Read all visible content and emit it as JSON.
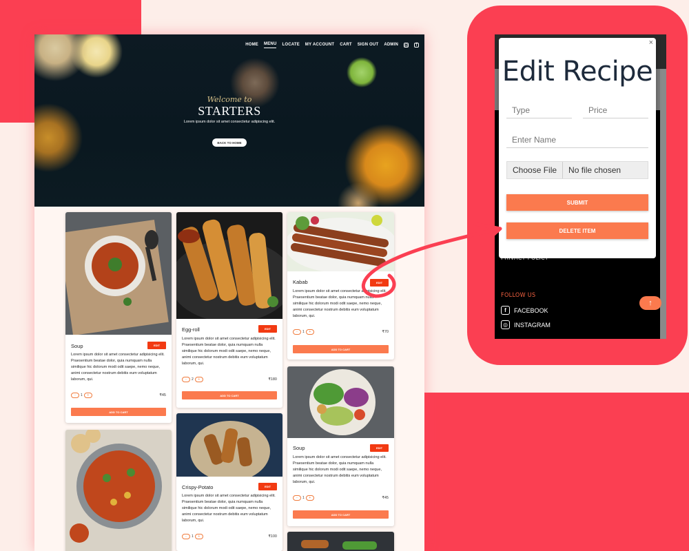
{
  "colors": {
    "brand_red": "#fb3f52",
    "accent_orange": "#fb7a4e",
    "edit_red": "#f23a12"
  },
  "nav": {
    "items": [
      "HOME",
      "MENU",
      "LOCATE",
      "MY ACCOUNT",
      "CART",
      "SIGN OUT",
      "ADMIN"
    ],
    "active": "MENU",
    "icons": [
      "instagram-icon",
      "facebook-icon"
    ]
  },
  "hero": {
    "welcome": "Welcome to",
    "title": "STARTERS",
    "subtitle": "Lorem ipsum dolor sit amet consectetur adipiscing elit.",
    "button": "BACK TO HOME"
  },
  "cards": [
    {
      "title": "Soup",
      "edit": "EDIT",
      "desc": "Lorem ipsum dolor sit amet consectetur adipisicing elit. Praesentium beatae dolor, quia numquam nulla similique hic dolorum modi odit saepe, nemo neque, animi consectetur nostrum debitis eum voluptatum laborum, qui.",
      "qty": "1",
      "price": "₹45",
      "cart": "ADD TO CART"
    },
    {
      "title": "Egg-roll",
      "edit": "EDIT",
      "desc": "Lorem ipsum dolor sit amet consectetur adipisicing elit. Praesentium beatae dolor, quia numquam nulla similique hic dolorum modi odit saepe, nemo neque, animi consectetur nostrum debitis eum voluptatum laborum, qui.",
      "qty": "2",
      "price": "₹180",
      "cart": "ADD TO CART"
    },
    {
      "title": "Kabab",
      "edit": "EDIT",
      "desc": "Lorem ipsum dolor sit amet consectetur adipisicing elit. Praesentium beatae dolor, quia numquam nulla similique hic dolorum modi odit saepe, nemo neque, animi consectetur nostrum debitis eum voluptatum laborum, qui.",
      "qty": "1",
      "price": "₹70",
      "cart": "ADD TO CART"
    },
    {
      "title": "Crispy-Potato",
      "edit": "EDIT",
      "desc": "Lorem ipsum dolor sit amet consectetur adipisicing elit. Praesentium beatae dolor, quia numquam nulla similique hic dolorum modi odit saepe, nemo neque, animi consectetur nostrum debitis eum voluptatum laborum, qui.",
      "qty": "1",
      "price": "₹100",
      "cart": "ADD TO CART"
    },
    {
      "title": "Soup",
      "edit": "EDIT",
      "desc": "Lorem ipsum dolor sit amet consectetur adipisicing elit. Praesentium beatae dolor, quia numquam nulla similique hic dolorum modi odit saepe, nemo neque, animi consectetur nostrum debitis eum voluptatum laborum, qui.",
      "qty": "1",
      "price": "₹45",
      "cart": "ADD TO CART"
    }
  ],
  "footer": {
    "privacy": "PRIVACY POLICY",
    "follow": "FOLLOW US",
    "facebook": "FACEBOOK",
    "instagram": "INSTAGRAM"
  },
  "modal": {
    "title": "Edit Recipe",
    "close": "×",
    "type_placeholder": "Type",
    "price_placeholder": "Price",
    "name_placeholder": "Enter Name",
    "file_button": "Choose File",
    "file_status": "No file chosen",
    "submit": "SUBMIT",
    "delete": "DELETE ITEM"
  }
}
